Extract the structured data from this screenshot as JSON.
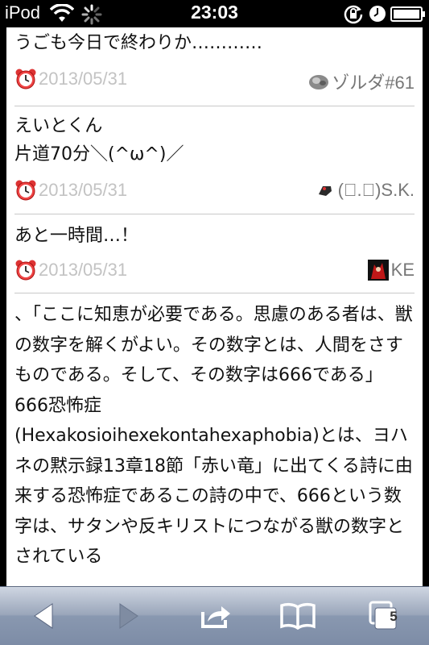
{
  "status_bar": {
    "carrier": "iPod",
    "time": "23:03"
  },
  "posts": [
    {
      "text": "うごも今日で終わりか…………",
      "date": "2013/05/31",
      "author": "ゾルダ#61"
    },
    {
      "text": "えいとくん\n片道70分＼(^ω^)／",
      "date": "2013/05/31",
      "author": "(ﾟ.ﾟ)S.K."
    },
    {
      "text": "あと一時間…！",
      "date": "2013/05/31",
      "author": "KE"
    }
  ],
  "long_post": {
    "text": "、「ここに知恵が必要である。思慮のある者は、獣の数字を解くがよい。その数字とは、人間をさすものである。そして、その数字は666である」\n666恐怖症\n(Hexakosioihexekontahexaphobia)とは、ヨハネの黙示録13章18節「赤い竜」に出てくる詩に由来する恐怖症であるこの詩の中で、666という数字は、サタンや反キリストにつながる獣の数字とされている"
  },
  "toolbar": {
    "tabs_count": "5"
  },
  "colors": {
    "toolbar_gradient_top": "#cfd6e2",
    "toolbar_gradient_bottom": "#7d8ca6",
    "date_color": "#c3c3c3"
  }
}
